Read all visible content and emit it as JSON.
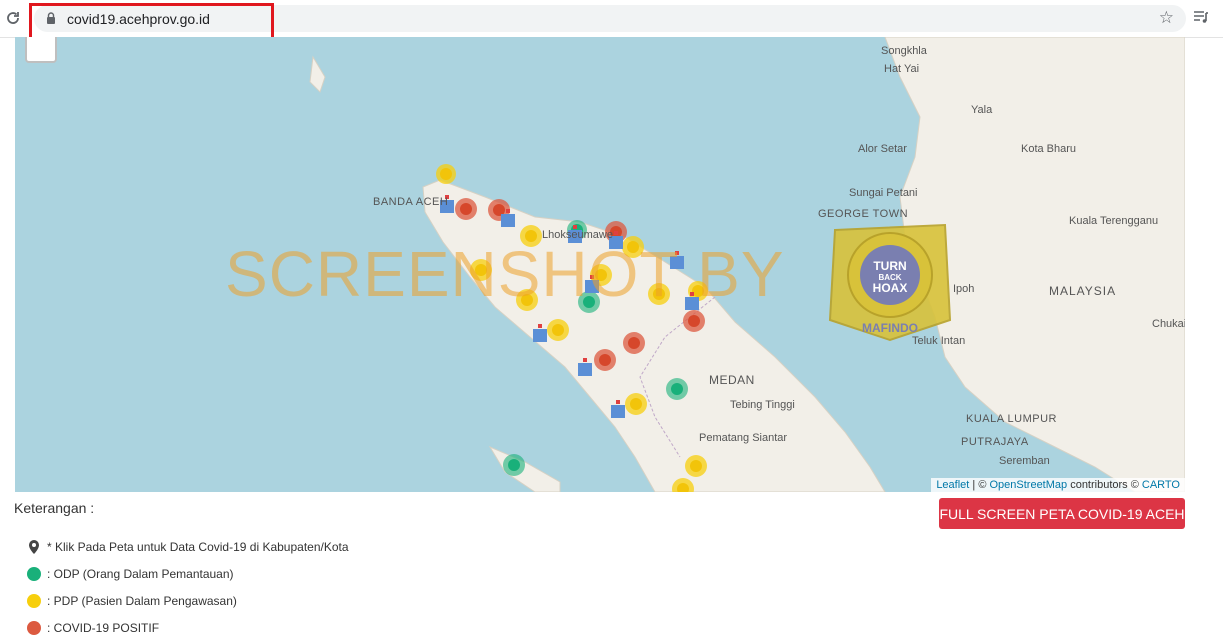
{
  "browser": {
    "url": "covid19.acehprov.go.id"
  },
  "map": {
    "labels": {
      "banda_aceh": "BANDA ACEH",
      "lhokseumawe": "Lhokseumawe",
      "medan": "MEDAN",
      "tebing_tinggi": "Tebing Tinggi",
      "pematang_siantar": "Pematang Siantar",
      "songkhla": "Songkhla",
      "hat_yai": "Hat Yai",
      "yala": "Yala",
      "alor_setar": "Alor Setar",
      "kota_bharu": "Kota Bharu",
      "sungai_petani": "Sungai Petani",
      "george_town": "GEORGE TOWN",
      "kuala_terengganu": "Kuala Terengganu",
      "malaysia": "MALAYSIA",
      "ipoh": "Ipoh",
      "teluk_intan": "Teluk Intan",
      "chukai": "Chukai",
      "kuala_lumpur": "KUALA LUMPUR",
      "putrajaya": "PUTRAJAYA",
      "seremban": "Seremban"
    },
    "watermark": "SCREENSHOT BY",
    "badge": {
      "ring_text": "MASYARAKAT ANTI FITNAH INDONESIA",
      "line1": "TURN",
      "line2": "BACK",
      "line3": "HOAX",
      "footer": "MAFINDO"
    },
    "attribution": {
      "leaflet": "Leaflet",
      "sep": " | © ",
      "osm": "OpenStreetMap",
      "mid": " contributors © ",
      "carto": "CARTO"
    }
  },
  "legend": {
    "title": "Keterangan :",
    "hint": "* Klik Pada Peta untuk Data Covid-19 di Kabupaten/Kota",
    "odp": ": ODP (Orang Dalam Pemantauan)",
    "pdp": ": PDP (Pasien Dalam Pengawasan)",
    "positif": ": COVID-19 POSITIF"
  },
  "button": {
    "fullscreen": "FULL SCREEN PETA COVID-19 ACEH"
  },
  "colors": {
    "odp": "#19b07a",
    "pdp": "#f7cf0d",
    "positif": "#dc5a40",
    "button": "#dc3545",
    "sea": "#abd3df",
    "land": "#f2efe8",
    "highlight": "#e0171e"
  }
}
